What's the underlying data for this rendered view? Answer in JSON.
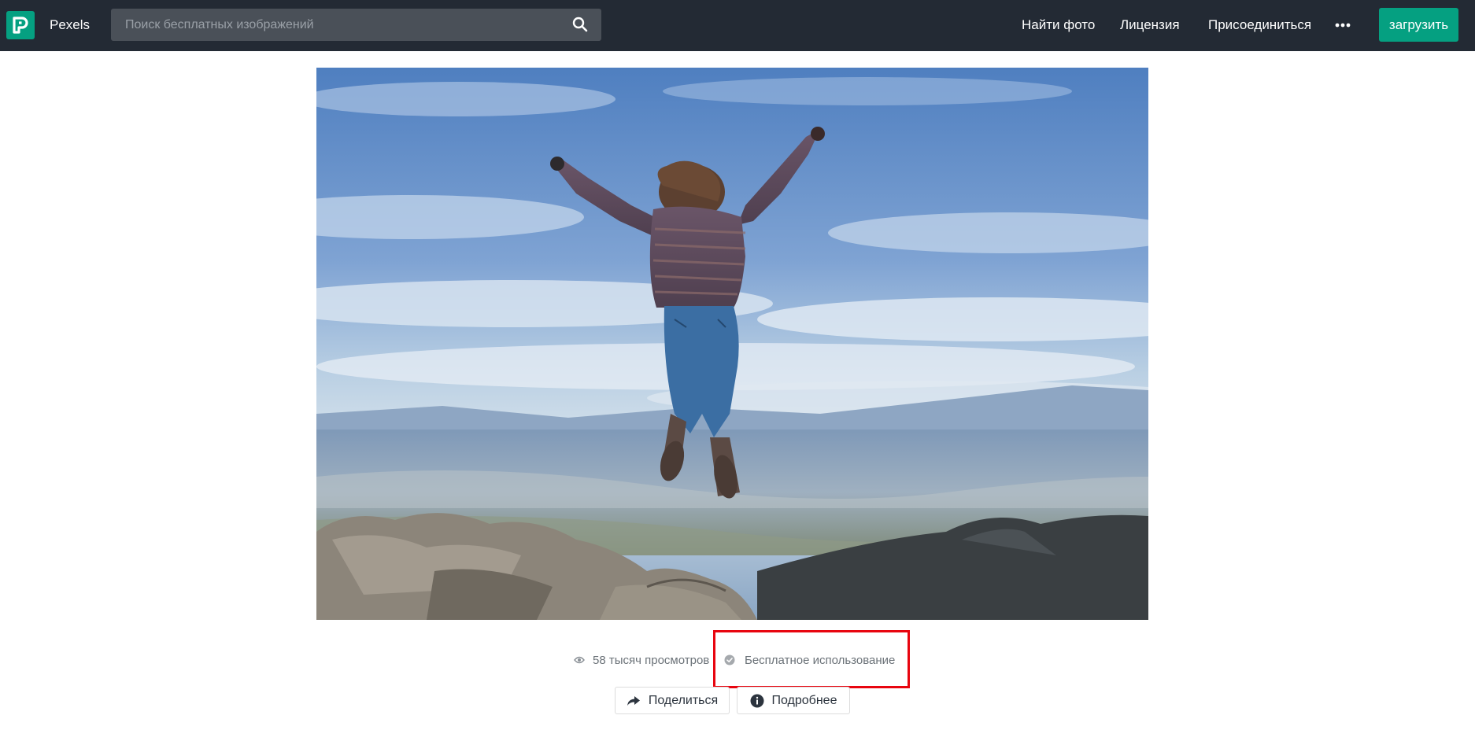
{
  "header": {
    "brand": "Pexels",
    "search_placeholder": "Поиск бесплатных изображений",
    "nav": [
      "Найти фото",
      "Лицензия",
      "Присоединиться"
    ],
    "upload_label": "загрузить",
    "icons": [
      "pexels-logo-icon",
      "search-icon",
      "more-dots-icon"
    ]
  },
  "photo": {
    "subject": "photo-woman-jumping-on-mountain"
  },
  "stats": {
    "views": "58 тысяч просмотров",
    "license": "Бесплатное использование"
  },
  "actions": {
    "share_label": "Поделиться",
    "info_label": "Подробнее"
  },
  "colors": {
    "header_bg": "#232a34",
    "accent": "#05a081",
    "highlight": "#e8050f"
  }
}
